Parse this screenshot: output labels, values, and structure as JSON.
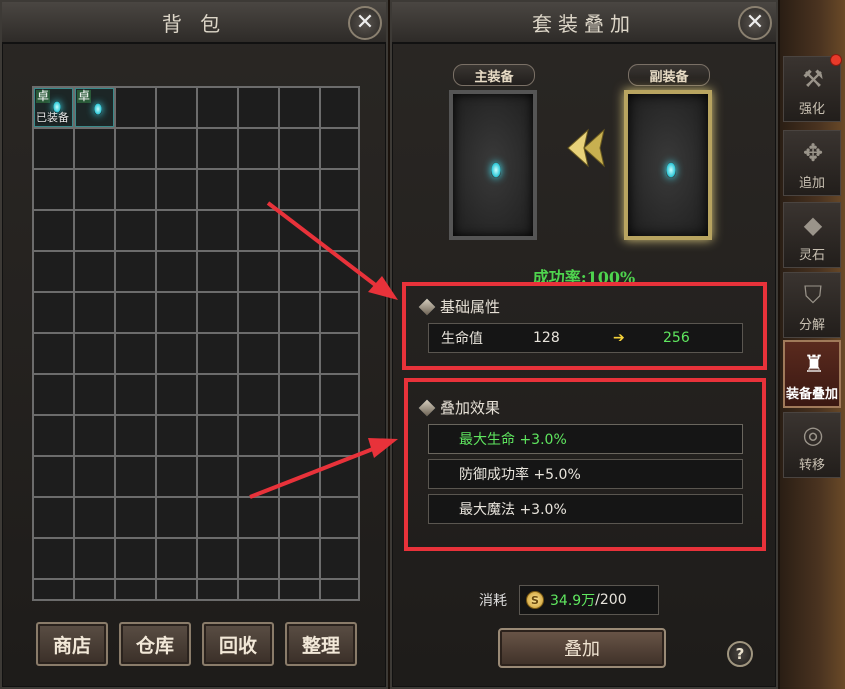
{
  "bag": {
    "title": "背 包",
    "slots": [
      {
        "grade": "卓",
        "equipped_label": "已装备"
      },
      {
        "grade": "卓"
      }
    ],
    "buttons": {
      "shop": "商店",
      "warehouse": "仓库",
      "recycle": "回收",
      "sort": "整理"
    }
  },
  "stack": {
    "title": "套装叠加",
    "main_equip_label": "主装备",
    "sub_equip_label": "副装备",
    "success_rate": "成功率:100%",
    "base_attr": {
      "title": "基础属性",
      "rows": [
        {
          "name": "生命值",
          "from": "128",
          "arrow": "➔",
          "to": "256"
        }
      ]
    },
    "stack_effect": {
      "title": "叠加效果",
      "rows": [
        {
          "text": "最大生命 +3.0%"
        },
        {
          "text": "防御成功率 +5.0%"
        },
        {
          "text": "最大魔法 +3.0%"
        }
      ]
    },
    "cost": {
      "label": "消耗",
      "amount": "34.9万",
      "separator": "/",
      "required": "200"
    },
    "stack_button": "叠加",
    "help": "?"
  },
  "side_tabs": [
    {
      "label": "强化",
      "icon": "hammer-icon"
    },
    {
      "label": "追加",
      "icon": "compass-icon"
    },
    {
      "label": "灵石",
      "icon": "crystal-icon"
    },
    {
      "label": "分解",
      "icon": "shield-icon"
    },
    {
      "label": "装备叠加",
      "icon": "armor-icon",
      "active": true
    },
    {
      "label": "转移",
      "icon": "orb-icon"
    }
  ],
  "colors": {
    "highlight_red": "#e8323a",
    "success_green": "#4ed44e",
    "value_green": "#5fe65f",
    "value_yellow": "#f5d23a"
  }
}
